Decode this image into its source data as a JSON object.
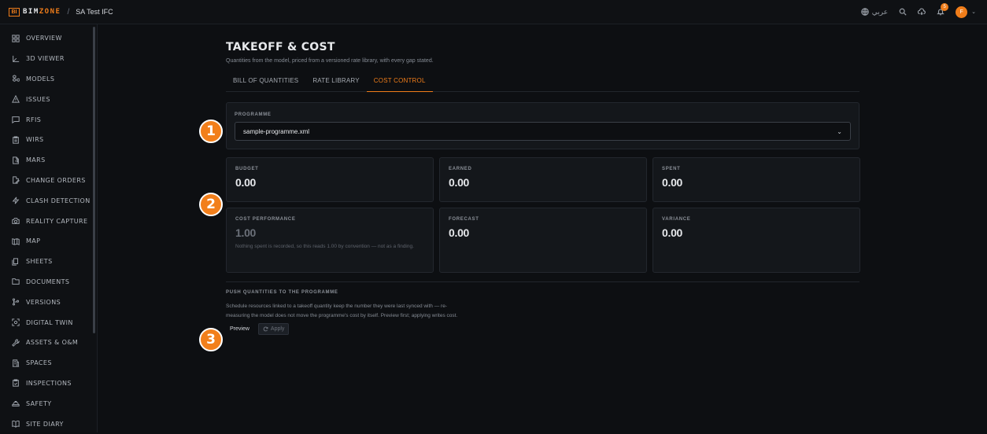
{
  "app": {
    "logo_mark": "BI",
    "logo_text_a": "BIM",
    "logo_text_b": "ZONE",
    "breadcrumb_sep": "/",
    "project": "SA Test IFC"
  },
  "topbar": {
    "language": "عربي",
    "notification_count": "5",
    "avatar_initial": "F",
    "avatar_caret": "⌄"
  },
  "sidebar": {
    "items": [
      {
        "label": "OVERVIEW",
        "icon": "grid-icon"
      },
      {
        "label": "3D VIEWER",
        "icon": "axes-icon"
      },
      {
        "label": "MODELS",
        "icon": "boxes-icon"
      },
      {
        "label": "ISSUES",
        "icon": "warning-icon"
      },
      {
        "label": "RFIS",
        "icon": "message-icon"
      },
      {
        "label": "WIRS",
        "icon": "clipboard-list-icon"
      },
      {
        "label": "MARS",
        "icon": "file-export-icon"
      },
      {
        "label": "CHANGE ORDERS",
        "icon": "file-edit-icon"
      },
      {
        "label": "CLASH DETECTION",
        "icon": "bolt-icon"
      },
      {
        "label": "REALITY CAPTURE",
        "icon": "camera-icon"
      },
      {
        "label": "MAP",
        "icon": "map-icon"
      },
      {
        "label": "SHEETS",
        "icon": "sheets-icon"
      },
      {
        "label": "DOCUMENTS",
        "icon": "folder-icon"
      },
      {
        "label": "VERSIONS",
        "icon": "branch-icon"
      },
      {
        "label": "DIGITAL TWIN",
        "icon": "scan-icon"
      },
      {
        "label": "ASSETS & O&M",
        "icon": "wrench-icon"
      },
      {
        "label": "SPACES",
        "icon": "building-icon"
      },
      {
        "label": "INSPECTIONS",
        "icon": "clipboard-check-icon"
      },
      {
        "label": "SAFETY",
        "icon": "hardhat-icon"
      },
      {
        "label": "SITE DIARY",
        "icon": "book-icon"
      }
    ]
  },
  "main": {
    "title": "TAKEOFF & COST",
    "subtitle": "Quantities from the model, priced from a versioned rate library, with every gap stated.",
    "tabs": [
      {
        "label": "BILL OF QUANTITIES",
        "active": false
      },
      {
        "label": "RATE LIBRARY",
        "active": false
      },
      {
        "label": "COST CONTROL",
        "active": true
      }
    ],
    "programme": {
      "label": "PROGRAMME",
      "selected": "sample-programme.xml"
    },
    "metrics": {
      "budget": {
        "label": "BUDGET",
        "value": "0.00"
      },
      "earned": {
        "label": "EARNED",
        "value": "0.00"
      },
      "spent": {
        "label": "SPENT",
        "value": "0.00"
      },
      "cpi": {
        "label": "COST PERFORMANCE",
        "value": "1.00",
        "note": "Nothing spent is recorded, so this reads 1.00 by convention — not as a finding."
      },
      "forecast": {
        "label": "FORECAST",
        "value": "0.00"
      },
      "variance": {
        "label": "VARIANCE",
        "value": "0.00"
      }
    },
    "push": {
      "title": "PUSH QUANTITIES TO THE PROGRAMME",
      "description": "Schedule resources linked to a takeoff quantity keep the number they were last synced with — re-measuring the model does not move the programme's cost by itself. Preview first; applying writes cost.",
      "preview_label": "Preview",
      "apply_label": "Apply"
    }
  },
  "markers": [
    "1",
    "2",
    "3"
  ],
  "colors": {
    "accent": "#f07d1a",
    "background": "#0d0f12",
    "card": "#14171b"
  }
}
